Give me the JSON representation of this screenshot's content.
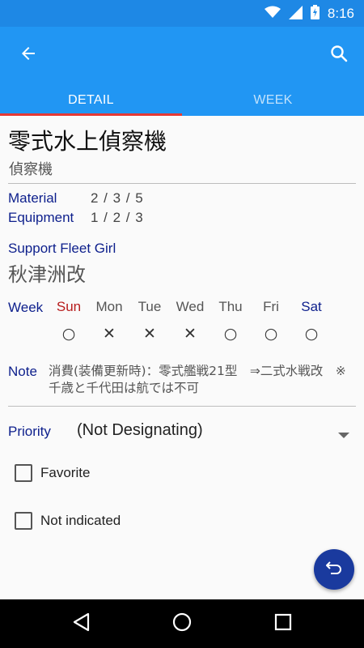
{
  "status_bar": {
    "time": "8:16",
    "icons": [
      "wifi-icon",
      "signal-icon",
      "battery-icon"
    ]
  },
  "app_bar": {
    "back_icon": "arrow-back-icon",
    "search_icon": "search-icon"
  },
  "tabs": [
    {
      "label": "DETAIL",
      "active": true
    },
    {
      "label": "WEEK",
      "active": false
    }
  ],
  "item": {
    "name": "零式水上偵察機",
    "type": "偵察機"
  },
  "material": {
    "label": "Material",
    "value": "2 / 3 / 5"
  },
  "equipment": {
    "label": "Equipment",
    "value": "1 / 2 / 3"
  },
  "support": {
    "label": "Support Fleet Girl",
    "name": "秋津洲改"
  },
  "week": {
    "label": "Week",
    "days": [
      {
        "label": "Sun",
        "mark": "○",
        "color": "#b71c1c"
      },
      {
        "label": "Mon",
        "mark": "✕",
        "color": "#555555"
      },
      {
        "label": "Tue",
        "mark": "✕",
        "color": "#555555"
      },
      {
        "label": "Wed",
        "mark": "✕",
        "color": "#555555"
      },
      {
        "label": "Thu",
        "mark": "○",
        "color": "#555555"
      },
      {
        "label": "Fri",
        "mark": "○",
        "color": "#555555"
      },
      {
        "label": "Sat",
        "mark": "○",
        "color": "#0d1f8c"
      }
    ]
  },
  "note": {
    "label": "Note",
    "text": "消費(装備更新時)：零式艦戦21型　⇒二式水戦改　※千歳と千代田は航では不可"
  },
  "priority": {
    "label": "Priority",
    "value": "(Not Designating)"
  },
  "checkboxes": [
    {
      "label": "Favorite",
      "checked": false
    },
    {
      "label": "Not indicated",
      "checked": false
    }
  ],
  "fab_icon": "undo-icon",
  "colors": {
    "primary": "#2196f3",
    "primary_dark": "#1e88e5",
    "accent": "#e53935",
    "label": "#0d1f8c",
    "fab": "#1a3a9e"
  }
}
